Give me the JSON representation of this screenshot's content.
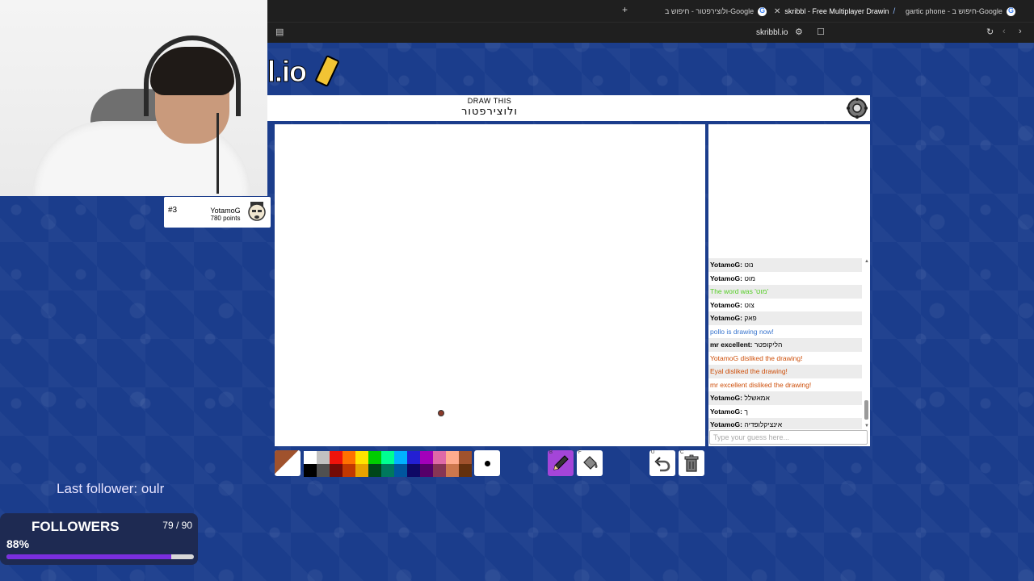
{
  "browser": {
    "tabs": [
      {
        "label": "ולוצירפטור - חיפוש ב-Google",
        "active": false
      },
      {
        "label": "skribbl - Free Multiplayer Drawin",
        "active": true
      },
      {
        "label": "gartic phone - חיפוש ב-Google",
        "active": false
      }
    ],
    "url": "skribbl.io"
  },
  "player": {
    "rank": "#3",
    "name": "YotamoG",
    "points": "780 points"
  },
  "game": {
    "logo_text": "l.io",
    "hint_label": "DRAW THIS",
    "word": "ולוצירפטור"
  },
  "chat": {
    "messages": [
      {
        "name": "YotamoG:",
        "text": "נוט",
        "style": "normal"
      },
      {
        "name": "YotamoG:",
        "text": "מוט",
        "style": "normal"
      },
      {
        "name": "",
        "text": "The word was 'מוט'",
        "style": "green"
      },
      {
        "name": "YotamoG:",
        "text": "צוט",
        "style": "normal"
      },
      {
        "name": "YotamoG:",
        "text": "פאק",
        "style": "normal"
      },
      {
        "name": "",
        "text": "pollo is drawing now!",
        "style": "blue"
      },
      {
        "name": "mr excellent:",
        "text": "הליקופטר",
        "style": "normal"
      },
      {
        "name": "",
        "text": "YotamoG disliked the drawing!",
        "style": "orange"
      },
      {
        "name": "",
        "text": "Eyal disliked the drawing!",
        "style": "orange"
      },
      {
        "name": "",
        "text": "mr excellent disliked the drawing!",
        "style": "orange"
      },
      {
        "name": "YotamoG:",
        "text": "אמאשלל",
        "style": "normal"
      },
      {
        "name": "YotamoG:",
        "text": "ך",
        "style": "normal"
      },
      {
        "name": "YotamoG:",
        "text": "אינציקלופדיה",
        "style": "normal"
      }
    ],
    "input_placeholder": "Type your guess here..."
  },
  "palette": {
    "colors": [
      "#ffffff",
      "#c1c1c1",
      "#ef130b",
      "#ff7100",
      "#ffe400",
      "#00cc00",
      "#00ff91",
      "#00b2ff",
      "#231fd3",
      "#a300ba",
      "#df69a7",
      "#ffac8e",
      "#a0522d",
      "#000000",
      "#505050",
      "#740b07",
      "#c23800",
      "#e8a200",
      "#004619",
      "#00785d",
      "#00569e",
      "#0e0865",
      "#550069",
      "#873554",
      "#cc774d",
      "#63300d"
    ],
    "selected_color": "#a0522d"
  },
  "tools": {
    "pen_key": "B",
    "fill_key": "F",
    "undo_key": "U",
    "clear_key": "C",
    "selected": "pen"
  },
  "stream": {
    "last_follower": "Last follower: oulr",
    "followers_title": "FOLLOWERS",
    "followers_count": "79 / 90",
    "followers_percent": "88%",
    "followers_progress": 0.88
  }
}
